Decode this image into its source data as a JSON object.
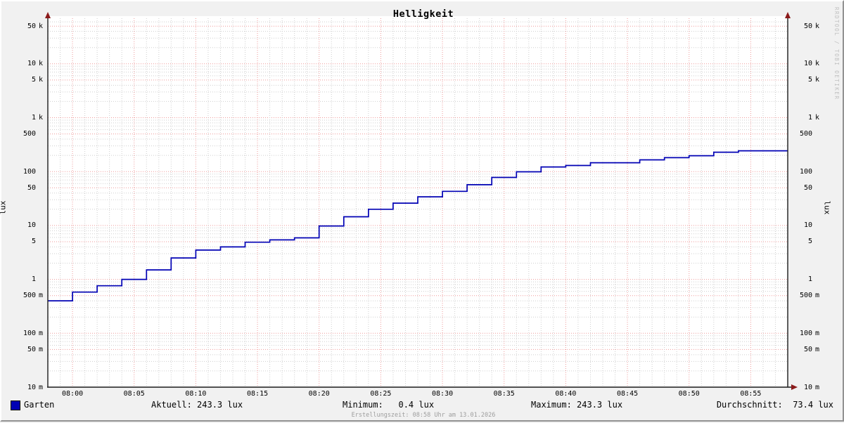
{
  "title": "Helligkeit",
  "watermark": "RRDTOOL / TOBI OETIKER",
  "y_axis": {
    "left_label": "lux",
    "right_label": "lux",
    "ticks": [
      {
        "num": "50",
        "suf": "k",
        "value": 50000
      },
      {
        "num": "10",
        "suf": "k",
        "value": 10000
      },
      {
        "num": "5",
        "suf": "k",
        "value": 5000
      },
      {
        "num": "1",
        "suf": "k",
        "value": 1000
      },
      {
        "num": "500",
        "suf": "",
        "value": 500
      },
      {
        "num": "100",
        "suf": "",
        "value": 100
      },
      {
        "num": "50",
        "suf": "",
        "value": 50
      },
      {
        "num": "10",
        "suf": "",
        "value": 10
      },
      {
        "num": "5",
        "suf": "",
        "value": 5
      },
      {
        "num": "1",
        "suf": "",
        "value": 1
      },
      {
        "num": "500",
        "suf": "m",
        "value": 0.5
      },
      {
        "num": "100",
        "suf": "m",
        "value": 0.1
      },
      {
        "num": "50",
        "suf": "m",
        "value": 0.05
      },
      {
        "num": "10",
        "suf": "m",
        "value": 0.01
      }
    ]
  },
  "x_axis": {
    "labels": [
      "08:00",
      "08:05",
      "08:10",
      "08:15",
      "08:20",
      "08:25",
      "08:30",
      "08:35",
      "08:40",
      "08:45",
      "08:50",
      "08:55"
    ]
  },
  "legend": {
    "series": "Garten",
    "aktuell": "Aktuell: 243.3 lux",
    "minimum": "Minimum:   0.4 lux",
    "maximum": "Maximum: 243.3 lux",
    "durchschnitt": "Durchschnitt:  73.4 lux"
  },
  "footer": {
    "created": "Erstellungszeit: 08:58 Uhr am 13.01.2026"
  },
  "colors": {
    "background": "#f1f1f1",
    "canvas": "#ffffff",
    "line": "#0000b4",
    "major_grid": "#ef9a9a",
    "minor_grid": "#cfcfcf",
    "axis": "#1a1a1a",
    "arrow": "#8b1a1a",
    "watermark_text": "#c0c0c0",
    "footer_text": "#9d9d9d"
  },
  "chart_data": {
    "type": "line",
    "style": "step-after",
    "title": "Helligkeit",
    "ylabel": "lux",
    "yscale": "log",
    "ylim": [
      0.01,
      63000
    ],
    "xlim": [
      "07:58",
      "08:58"
    ],
    "grid": true,
    "legend_position": "bottom",
    "series": [
      {
        "name": "Garten",
        "color": "#0000b4",
        "unit": "lux",
        "steps": [
          [
            "07:58",
            0.4
          ],
          [
            "08:00",
            0.58
          ],
          [
            "08:02",
            0.76
          ],
          [
            "08:04",
            1.0
          ],
          [
            "08:06",
            1.5
          ],
          [
            "08:08",
            2.5
          ],
          [
            "08:10",
            3.5
          ],
          [
            "08:12",
            4.0
          ],
          [
            "08:14",
            4.9
          ],
          [
            "08:16",
            5.4
          ],
          [
            "08:18",
            5.9
          ],
          [
            "08:20",
            9.8
          ],
          [
            "08:22",
            14.5
          ],
          [
            "08:24",
            20
          ],
          [
            "08:26",
            26
          ],
          [
            "08:28",
            34
          ],
          [
            "08:30",
            43
          ],
          [
            "08:32",
            57
          ],
          [
            "08:34",
            78
          ],
          [
            "08:36",
            99
          ],
          [
            "08:38",
            122
          ],
          [
            "08:40",
            130
          ],
          [
            "08:42",
            146
          ],
          [
            "08:46",
            165
          ],
          [
            "08:48",
            181
          ],
          [
            "08:50",
            197
          ],
          [
            "08:52",
            229
          ],
          [
            "08:54",
            243.3
          ]
        ],
        "end_time": "08:58",
        "stats": {
          "aktuell": 243.3,
          "minimum": 0.4,
          "maximum": 243.3,
          "durchschnitt": 73.4
        }
      }
    ]
  }
}
